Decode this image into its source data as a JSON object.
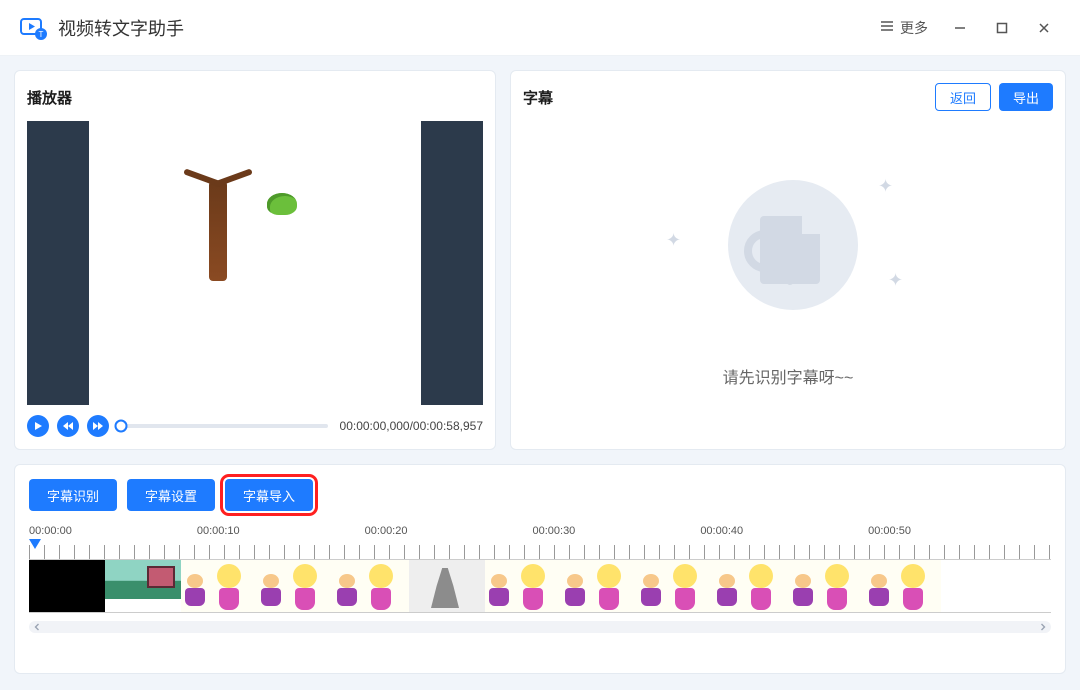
{
  "app": {
    "title": "视频转文字助手",
    "more_label": "更多"
  },
  "player": {
    "panel_title": "播放器",
    "time_display": "00:00:00,000/00:00:58,957"
  },
  "subtitle": {
    "panel_title": "字幕",
    "back_label": "返回",
    "export_label": "导出",
    "empty_text": "请先识别字幕呀~~"
  },
  "timeline": {
    "buttons": {
      "recognize": "字幕识别",
      "settings": "字幕设置",
      "import": "字幕导入"
    },
    "ruler_labels": [
      "00:00:00",
      "00:00:10",
      "00:00:20",
      "00:00:30",
      "00:00:40",
      "00:00:50"
    ]
  }
}
